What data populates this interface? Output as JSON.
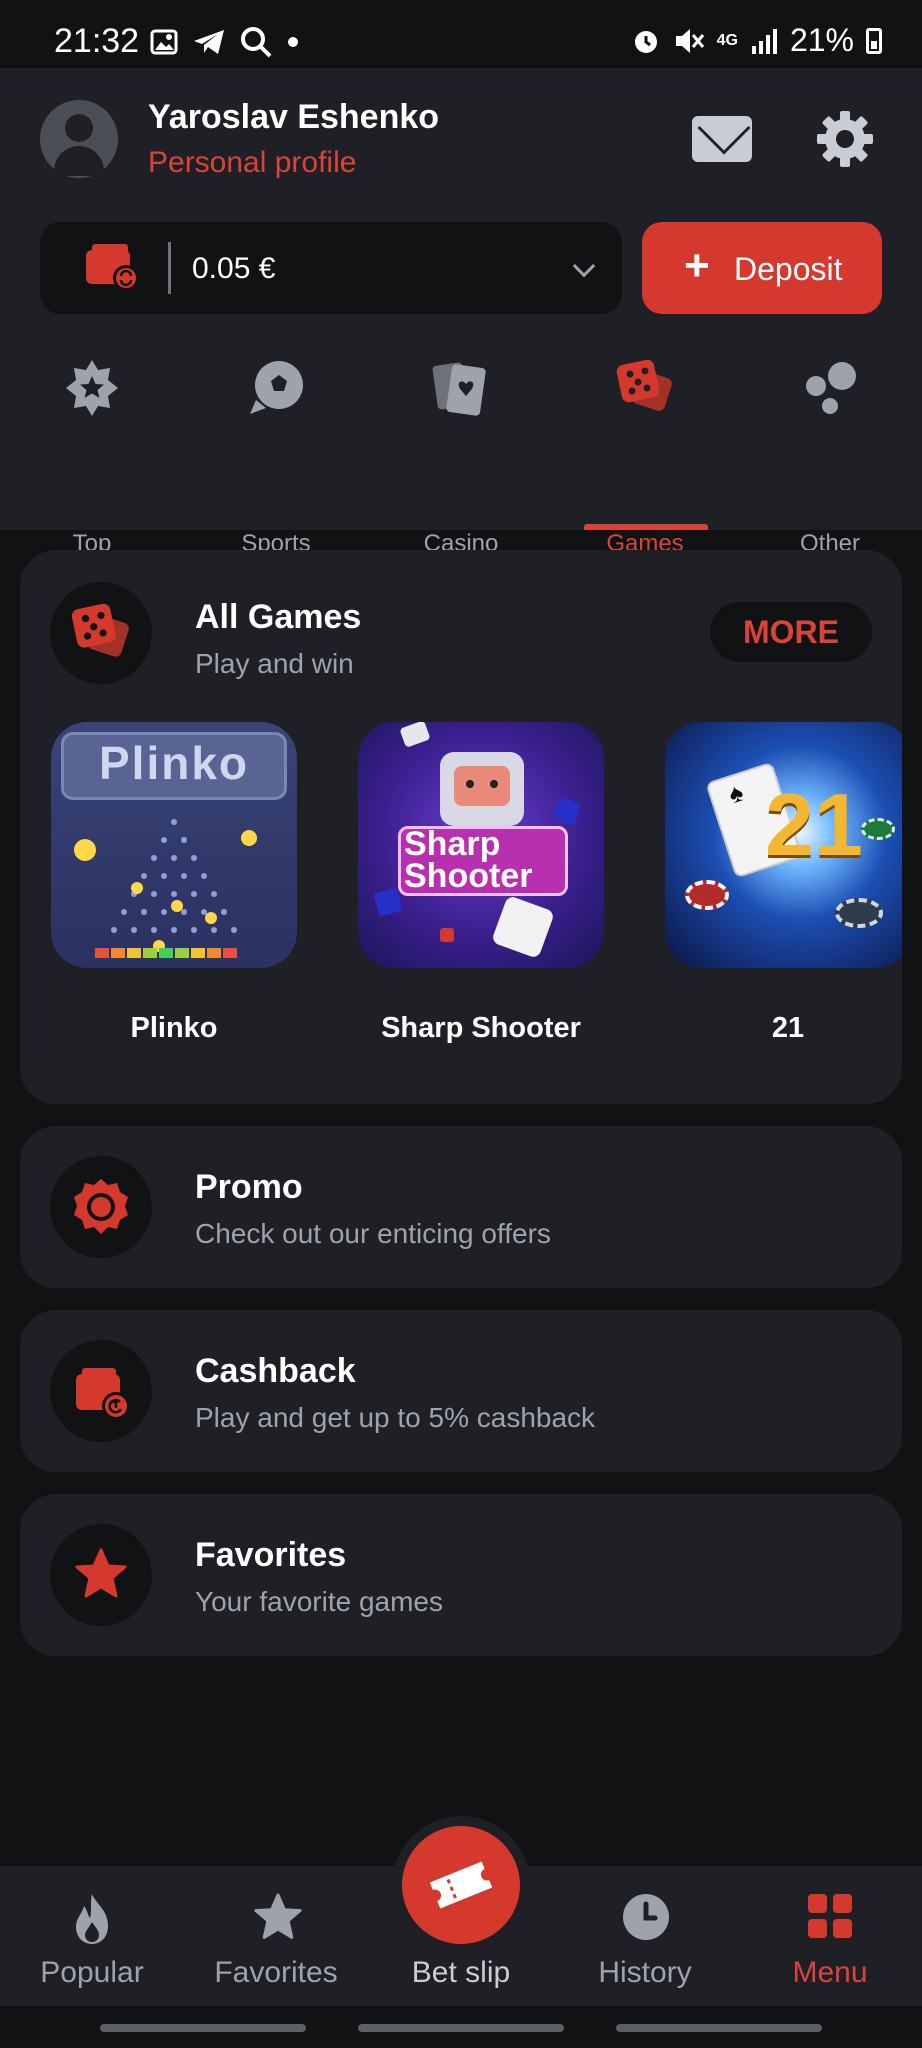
{
  "status_bar": {
    "time": "21:32",
    "battery": "21%",
    "network": "4G"
  },
  "profile": {
    "name": "Yaroslav Eshenko",
    "subtitle": "Personal profile"
  },
  "balance": {
    "amount": "0.05 €"
  },
  "deposit_label": "Deposit",
  "categories": [
    {
      "label": "Top",
      "icon": "star-badge-icon"
    },
    {
      "label": "Sports",
      "icon": "soccer-ball-icon"
    },
    {
      "label": "Casino",
      "icon": "playing-cards-icon"
    },
    {
      "label": "Games",
      "icon": "dice-icon",
      "active": true
    },
    {
      "label": "Other",
      "icon": "bubbles-icon"
    }
  ],
  "all_games": {
    "title": "All Games",
    "subtitle": "Play and win",
    "more_label": "MORE",
    "games": [
      {
        "name": "Plinko",
        "logo_text": "Plinko"
      },
      {
        "name": "Sharp Shooter",
        "logo_text_1": "Sharp",
        "logo_text_2": "Shooter"
      },
      {
        "name": "21",
        "logo_text": "21"
      }
    ]
  },
  "menu_cards": [
    {
      "title": "Promo",
      "subtitle": "Check out our enticing offers",
      "icon": "promo-badge-icon"
    },
    {
      "title": "Cashback",
      "subtitle": "Play and get up to 5% cashback",
      "icon": "cashback-wallet-icon"
    },
    {
      "title": "Favorites",
      "subtitle": "Your favorite games",
      "icon": "star-icon"
    }
  ],
  "bottom_nav": [
    {
      "label": "Popular",
      "icon": "flame-icon"
    },
    {
      "label": "Favorites",
      "icon": "star-icon"
    },
    {
      "label": "Bet slip",
      "icon": "ticket-icon"
    },
    {
      "label": "History",
      "icon": "clock-icon"
    },
    {
      "label": "Menu",
      "icon": "grid-icon",
      "active": true
    }
  ],
  "colors": {
    "accent": "#d5392e",
    "background": "#111213",
    "surface": "#1e2025",
    "muted_text": "#9ea2aa"
  }
}
